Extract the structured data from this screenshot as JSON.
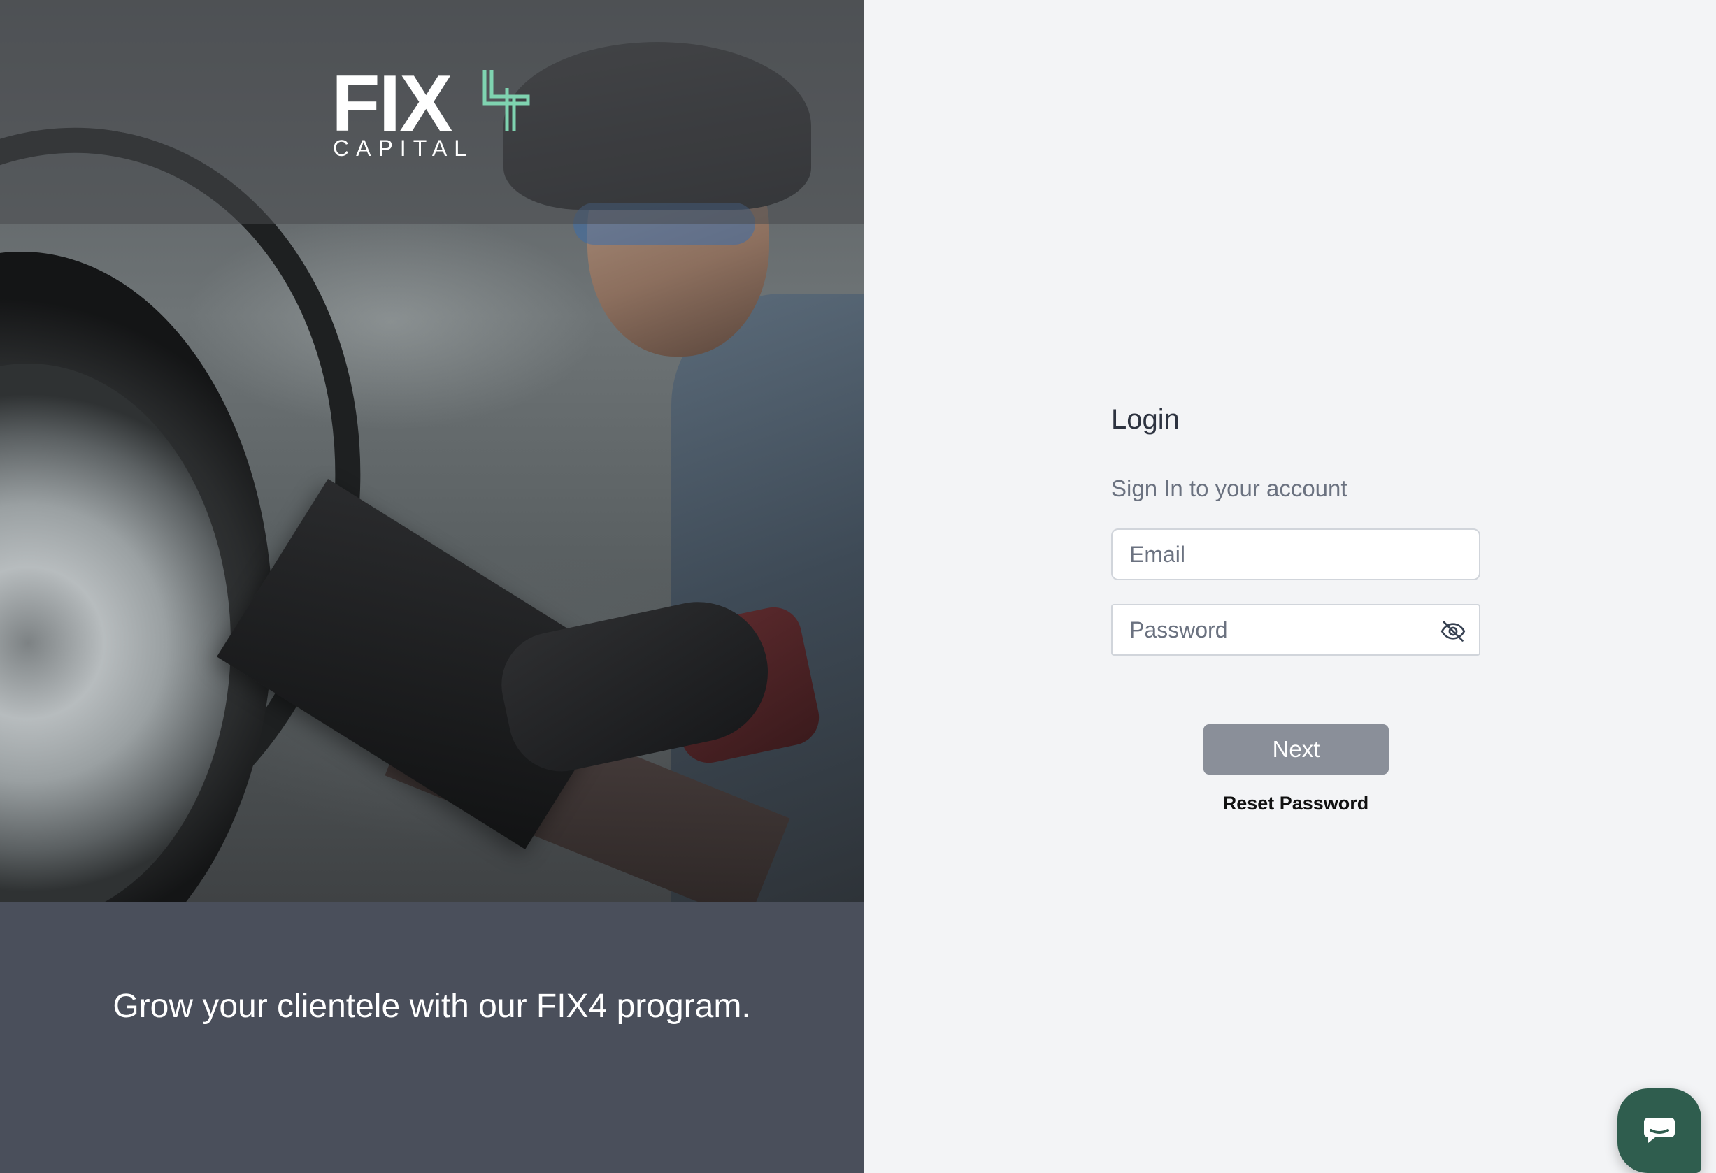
{
  "hero": {
    "logo": {
      "word": "FIX",
      "sub": "CAPITAL"
    },
    "tagline": "Grow your clientele with our FIX4 program."
  },
  "login": {
    "title": "Login",
    "subtitle": "Sign In to your account",
    "email_placeholder": "Email",
    "email_value": "",
    "password_placeholder": "Password",
    "password_value": "",
    "password_toggle_icon": "eye-slash-icon",
    "next_label": "Next",
    "reset_label": "Reset Password"
  },
  "chat": {
    "icon": "chat-bubble-icon"
  },
  "colors": {
    "hero_bg": "#4a4f5b",
    "panel_bg": "#f3f4f6",
    "button_bg": "#8a8f99",
    "logo_accent": "#7fd3b0",
    "chat_bg": "#2f5d4e"
  }
}
